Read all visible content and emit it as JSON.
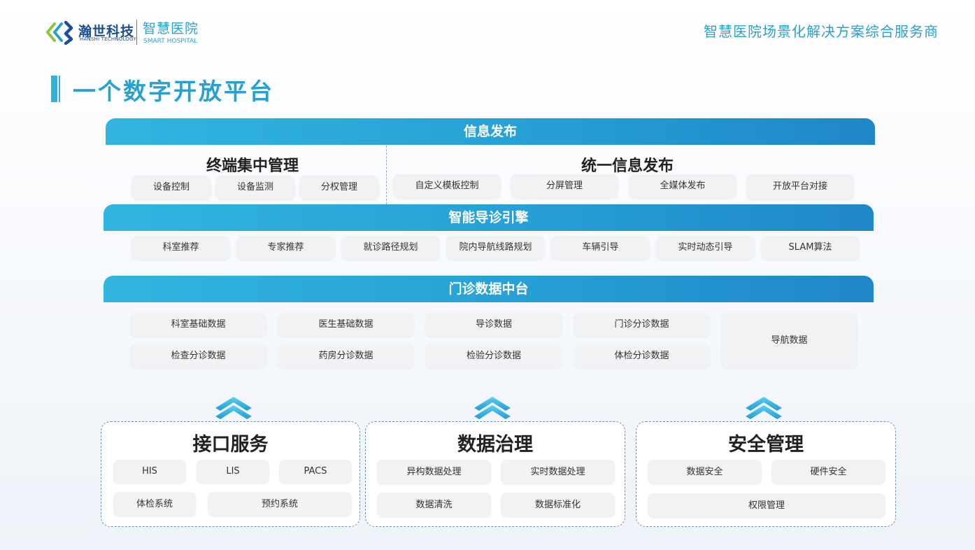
{
  "header": {
    "logo_cn": "瀚世科技",
    "logo_en": "HANSHI TECHNOLOGY",
    "logo_sub_cn": "智慧医院",
    "logo_sub_en": "SMART HOSPITAL",
    "slogan": "智慧医院场景化解决方案综合服务商"
  },
  "page_title": "一个数字开放平台",
  "info_release": {
    "band": "信息发布",
    "terminal": {
      "title": "终端集中管理",
      "items": [
        "设备控制",
        "设备监测",
        "分权管理"
      ]
    },
    "unified": {
      "title": "统一信息发布",
      "items": [
        "自定义模板控制",
        "分屏管理",
        "全媒体发布",
        "开放平台对接"
      ]
    }
  },
  "guidance": {
    "band": "智能导诊引擎",
    "items": [
      "科室推荐",
      "专家推荐",
      "就诊路径规划",
      "院内导航线路规划",
      "车辆引导",
      "实时动态引导",
      "SLAM算法"
    ]
  },
  "data_center": {
    "band": "门诊数据中台",
    "row1": [
      "科室基础数据",
      "医生基础数据",
      "导诊数据",
      "门诊分诊数据"
    ],
    "row2": [
      "检查分诊数据",
      "药房分诊数据",
      "检验分诊数据",
      "体检分诊数据"
    ],
    "nav": "导航数据"
  },
  "panels": {
    "interface": {
      "title": "接口服务",
      "items": [
        "HIS",
        "LIS",
        "PACS",
        "体检系统",
        "预约系统"
      ]
    },
    "governance": {
      "title": "数据治理",
      "items": [
        "异构数据处理",
        "实时数据处理",
        "数据清洗",
        "数据标准化"
      ]
    },
    "security": {
      "title": "安全管理",
      "items": [
        "数据安全",
        "硬件安全",
        "权限管理"
      ]
    }
  },
  "colors": {
    "accent": "#2aa0cf",
    "band_start": "#32b5df",
    "band_end": "#1f87c8",
    "logo_blue": "#1c4f93",
    "pill_bg": "#f1f2f4"
  }
}
